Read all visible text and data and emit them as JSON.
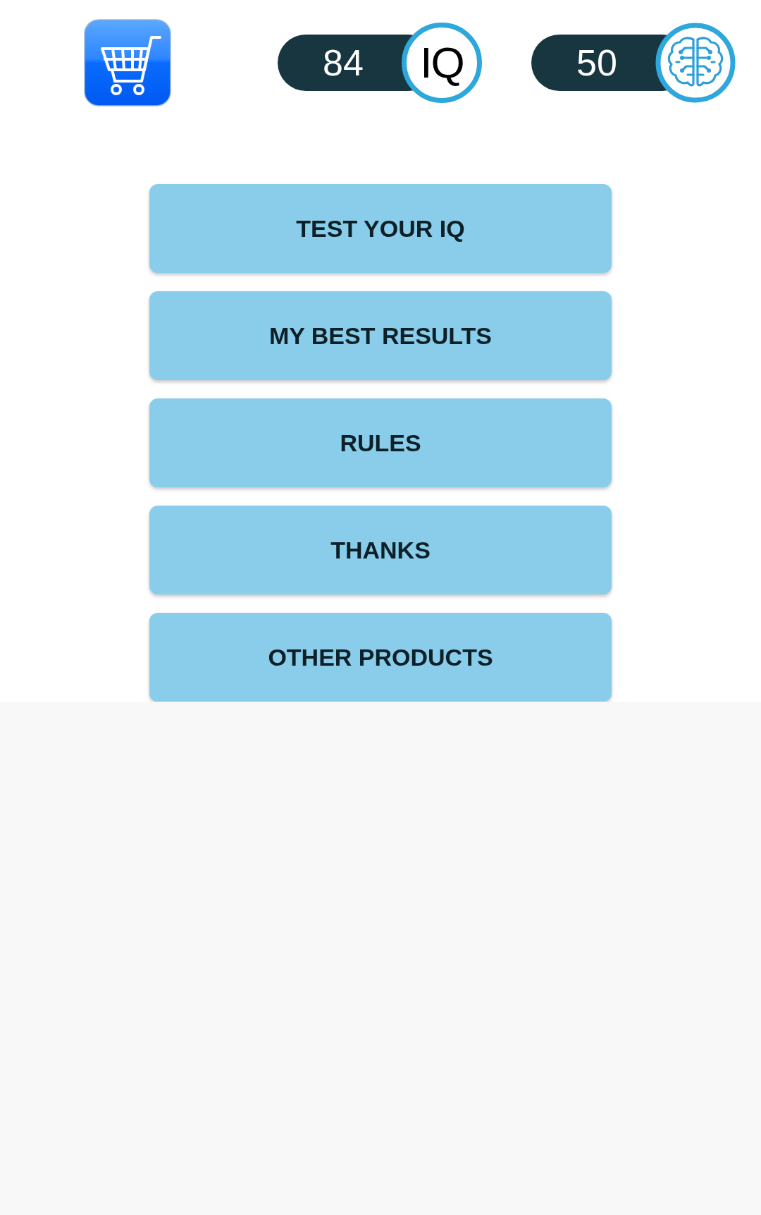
{
  "stats": [
    {
      "kind": "iq",
      "value": "84",
      "badge_text": "IQ"
    },
    {
      "kind": "brain",
      "value": "50"
    }
  ],
  "menu": [
    {
      "label": "TEST YOUR IQ"
    },
    {
      "label": "MY BEST RESULTS"
    },
    {
      "label": "RULES"
    },
    {
      "label": "THANKS"
    },
    {
      "label": "OTHER PRODUCTS"
    }
  ]
}
